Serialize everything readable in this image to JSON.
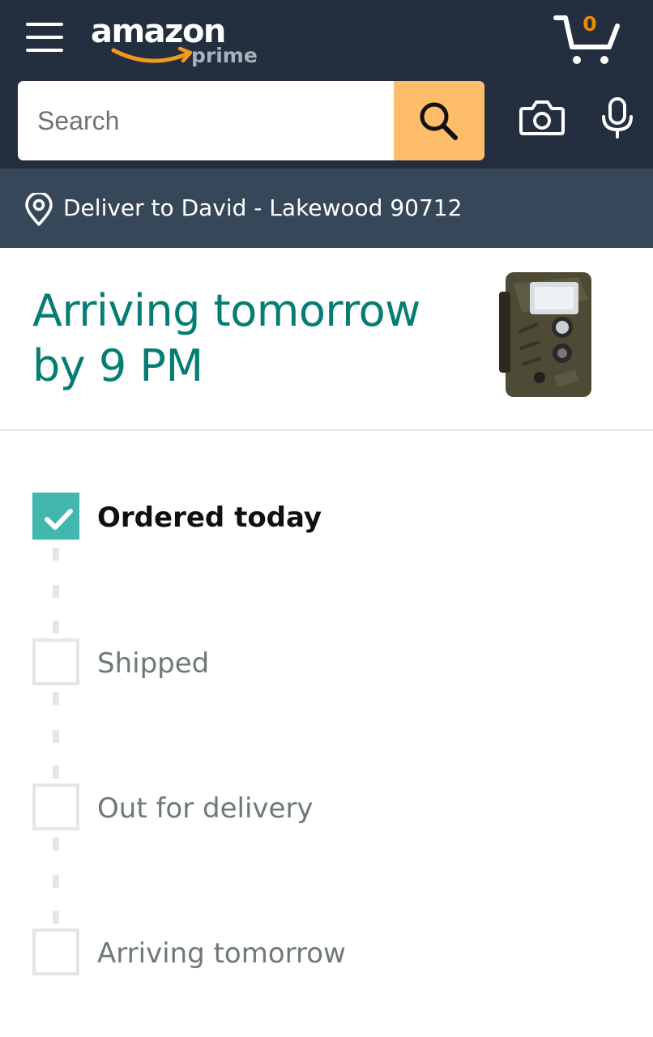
{
  "header": {
    "logo_text": "amazon",
    "logo_subtext": "prime",
    "cart_count": "0",
    "search_placeholder": "Search"
  },
  "deliver": {
    "text": "Deliver to David - Lakewood 90712"
  },
  "arrival": {
    "title": "Arriving tomorrow by 9 PM"
  },
  "tracker": {
    "steps": [
      {
        "label": "Ordered today",
        "completed": true
      },
      {
        "label": "Shipped",
        "completed": false
      },
      {
        "label": "Out for delivery",
        "completed": false
      },
      {
        "label": "Arriving tomorrow",
        "completed": false
      }
    ]
  },
  "colors": {
    "header_bg": "#232f3e",
    "deliver_bg": "#37475a",
    "search_button": "#febd69",
    "arrival_text": "#067d73",
    "check_fill": "#41b7ae",
    "cart_count": "#f08804"
  },
  "icons": [
    "menu-icon",
    "cart-icon",
    "search-icon",
    "camera-icon",
    "microphone-icon",
    "location-pin-icon",
    "checkmark-icon"
  ]
}
